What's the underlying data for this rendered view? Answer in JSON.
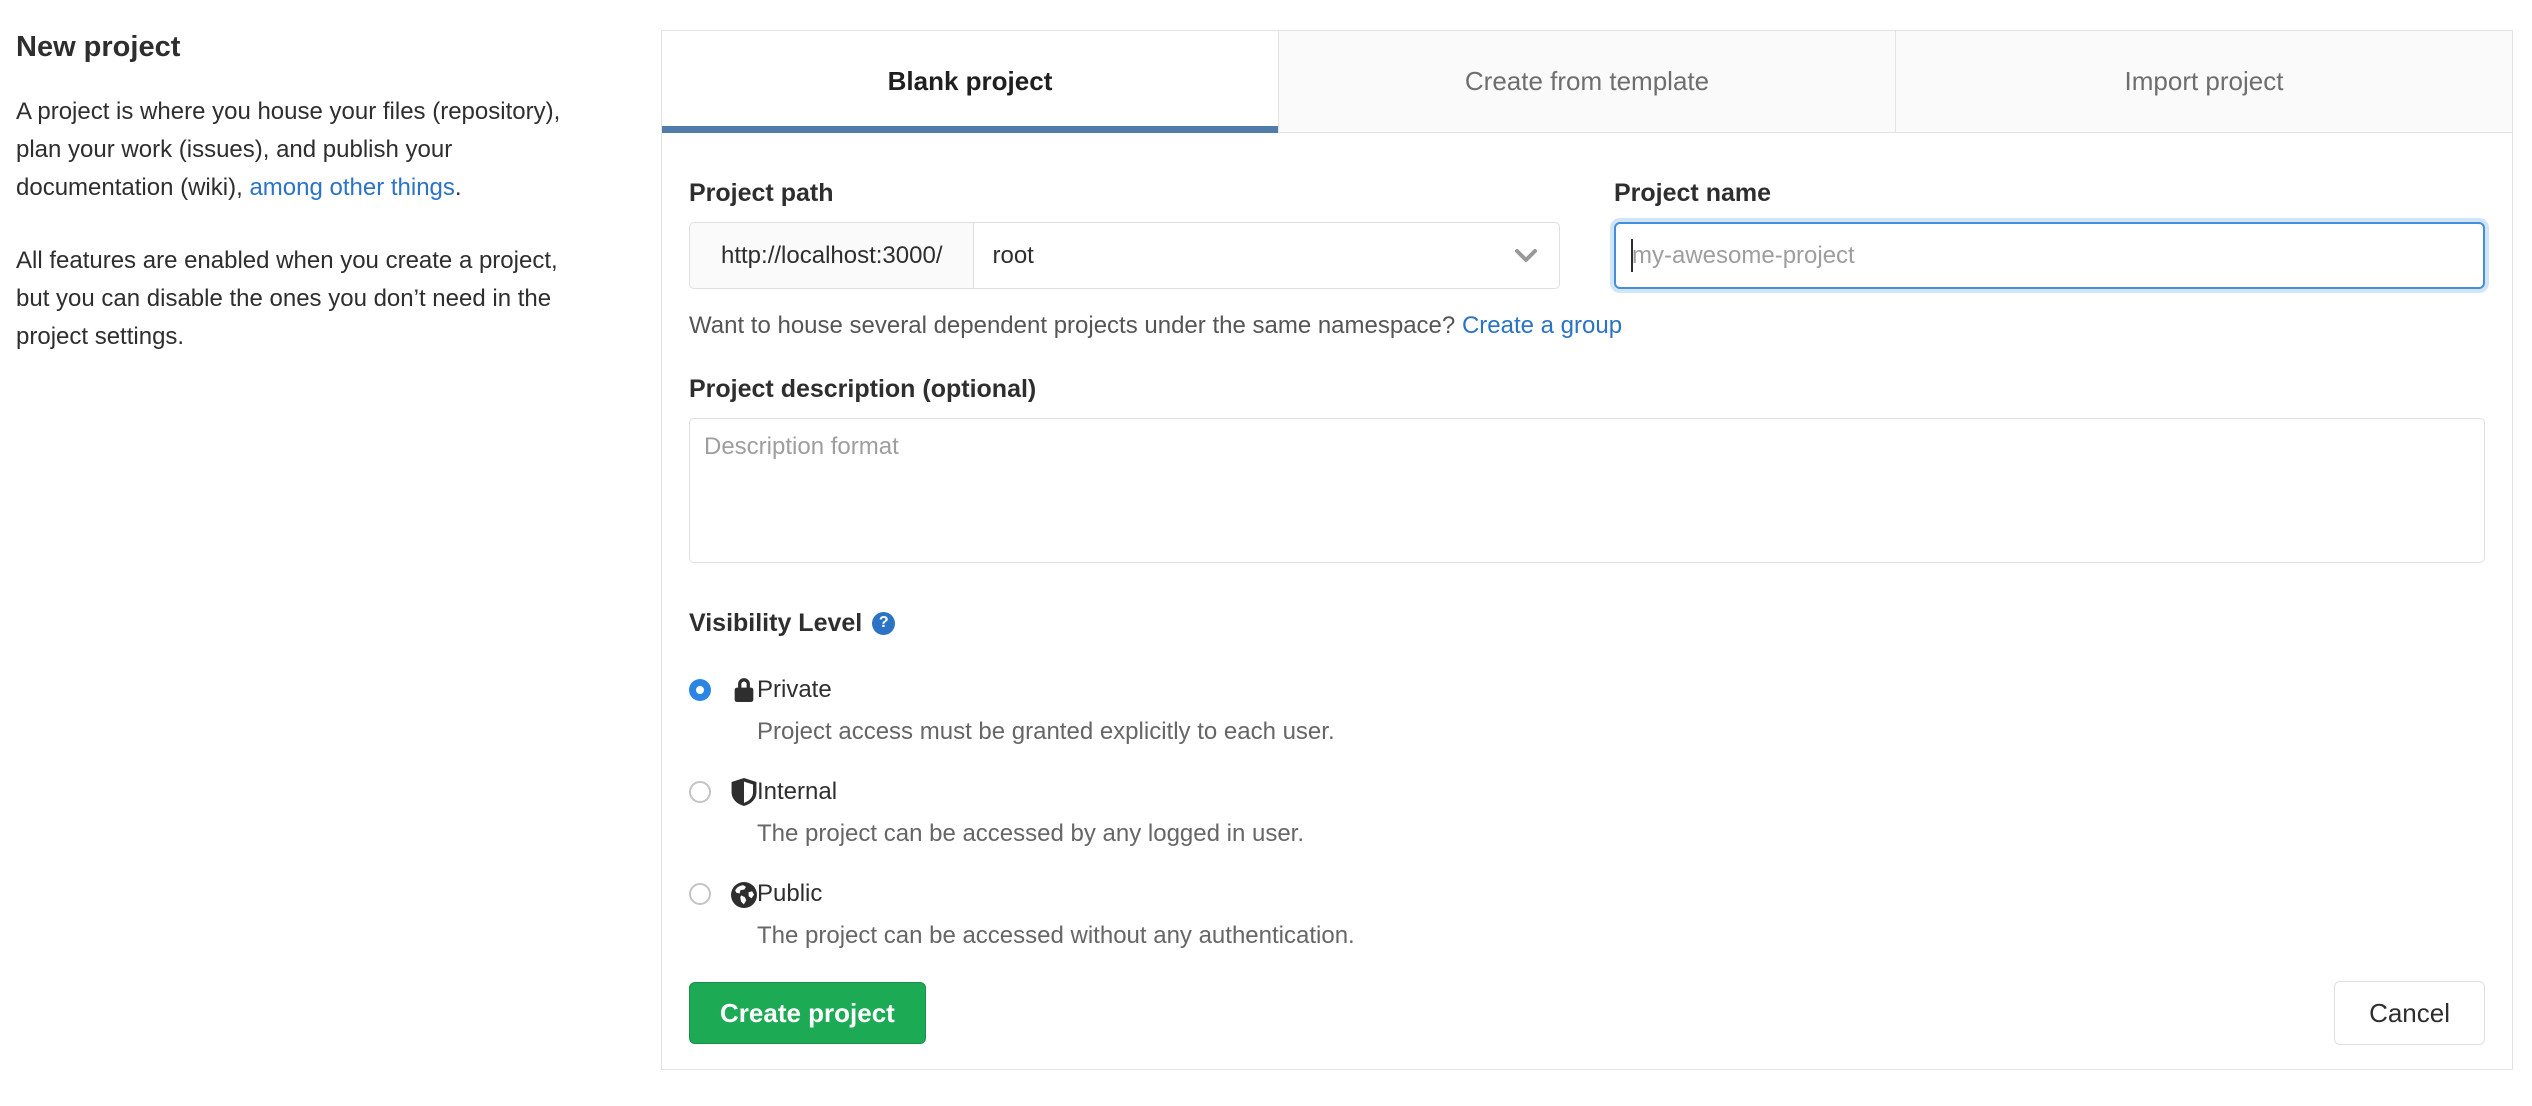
{
  "sidebar": {
    "title": "New project",
    "para1_pre": "A project is where you house your files (repository), plan your work (issues), and publish your documentation (wiki), ",
    "para1_link": "among other things",
    "para1_post": ".",
    "para2": "All features are enabled when you create a project, but you can disable the ones you don’t need in the project settings."
  },
  "tabs": [
    {
      "label": "Blank project",
      "active": true
    },
    {
      "label": "Create from template",
      "active": false
    },
    {
      "label": "Import project",
      "active": false
    }
  ],
  "form": {
    "project_path": {
      "label": "Project path",
      "url_prefix": "http://localhost:3000/",
      "namespace_selected": "root"
    },
    "project_name": {
      "label": "Project name",
      "placeholder": "my-awesome-project",
      "value": ""
    },
    "namespace_hint_text": "Want to house several dependent projects under the same namespace?",
    "namespace_hint_link": "Create a group",
    "description": {
      "label": "Project description (optional)",
      "placeholder": "Description format",
      "value": ""
    },
    "visibility": {
      "label": "Visibility Level",
      "options": [
        {
          "name": "Private",
          "description": "Project access must be granted explicitly to each user.",
          "selected": true,
          "icon": "lock-icon"
        },
        {
          "name": "Internal",
          "description": "The project can be accessed by any logged in user.",
          "selected": false,
          "icon": "shield-icon"
        },
        {
          "name": "Public",
          "description": "The project can be accessed without any authentication.",
          "selected": false,
          "icon": "globe-icon"
        }
      ]
    },
    "submit_label": "Create project",
    "cancel_label": "Cancel"
  },
  "colors": {
    "link_blue": "#2a73c5",
    "tab_active_underline": "#4f7cab",
    "focused_input_border": "#428fdc",
    "radio_selected_blue": "#2b86e3",
    "create_button_green": "#1caa55",
    "icon_dark": "#2e2e2e"
  }
}
